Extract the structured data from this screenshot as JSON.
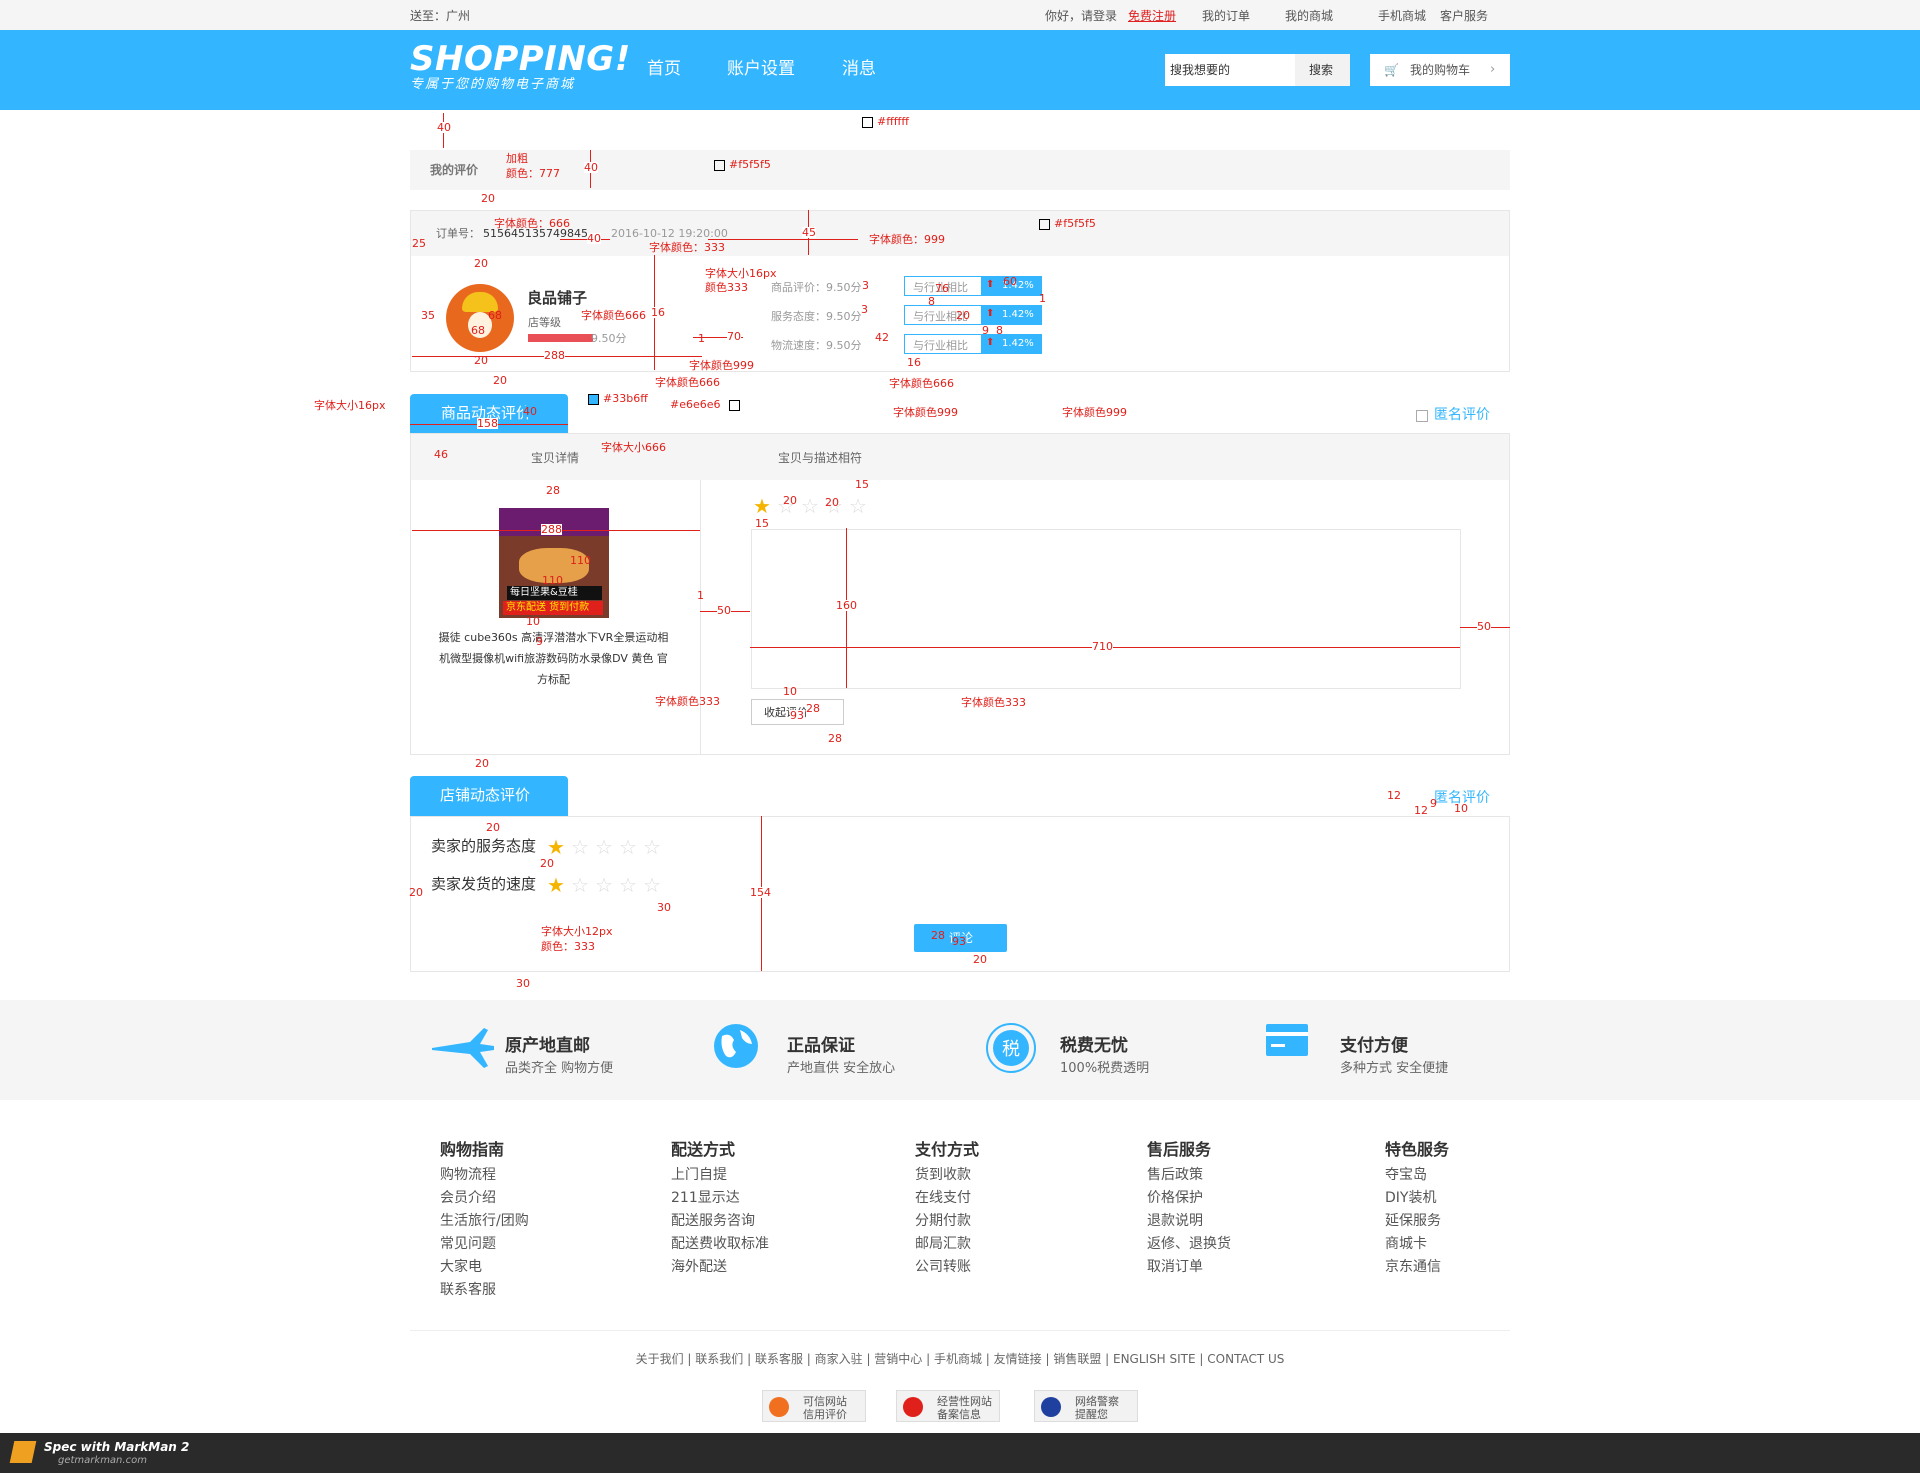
{
  "topbar": {
    "location": "送至：广州",
    "greeting": "你好，请登录",
    "register": "免费注册",
    "my_orders": "我的订单",
    "my_mall": "我的商城",
    "mobile_mall": "手机商城",
    "customer_service": "客户服务"
  },
  "header": {
    "logo": "SHOPPING!",
    "slogan": "专属于您的购物电子商城",
    "nav": [
      "首页",
      "账户设置",
      "消息"
    ],
    "search_placeholder": "搜我想要的",
    "search_button": "搜索",
    "cart": "我的购物车"
  },
  "review": {
    "section_title": "我的评价",
    "order_label": "订单号：",
    "order_no": "515645135749845",
    "order_time": "2016-10-12   19:20:00",
    "shop_name": "良品铺子",
    "shop_level": "店等级",
    "shop_score": "9.50分",
    "metrics": [
      {
        "label": "商品评价：9.50分",
        "compare": "与行业相比",
        "value": "1.42%"
      },
      {
        "label": "服务态度：9.50分",
        "compare": "与行业相比",
        "value": "1.42%"
      },
      {
        "label": "物流速度：9.50分",
        "compare": "与行业相比",
        "value": "1.42%"
      }
    ],
    "product_tab": "商品动态评价",
    "anonymous": "匿名评价",
    "col_product": "宝贝详情",
    "col_match": "宝贝与描述相符",
    "product_img_text1": "每日坚果&豆桂",
    "product_img_text2": "京东配送 货到付款",
    "product_title": "摄徒 cube360s 高清浮潜潜水下VR全景运动相机微型摄像机wifi旅游数码防水录像DV 黄色 官方标配",
    "collapse_btn": "收起评价",
    "match_rating": 1,
    "shop_tab": "店铺动态评价",
    "service_label": "卖家的服务态度",
    "delivery_label": "卖家发货的速度",
    "service_rating": 1,
    "delivery_rating": 1,
    "submit_btn": "评论"
  },
  "annotations": {
    "a40": "40",
    "a20": "20",
    "a25": "25",
    "a45": "45",
    "a35": "35",
    "a68": "68",
    "a288": "288",
    "a16": "16",
    "a1": "1",
    "a3": "3",
    "a8": "8",
    "a9": "9",
    "a60": "60",
    "a70": "70",
    "a42": "42",
    "a76": "76",
    "a158": "158",
    "a46": "46",
    "a28": "28",
    "a15": "15",
    "a110": "110",
    "a10": "10",
    "a50": "50",
    "a160": "160",
    "a710": "710",
    "a93": "93",
    "a154": "154",
    "a30": "30",
    "a12": "12",
    "ffffff": "#ffffff",
    "f5f5f5": "#f5f5f5",
    "c33b6ff": "#33b6ff",
    "e6e6e6": "#e6e6e6",
    "bold": "加粗",
    "color777": "颜色：777",
    "fc666": "字体颜色：666",
    "fc333": "字体颜色：333",
    "fc999": "字体颜色：999",
    "fs16": "字体大小16px",
    "c333": "颜色333",
    "fc666b": "字体颜色666",
    "fc999b": "字体颜色999",
    "fs16b": "字体大小16px",
    "fs666": "字体大小666",
    "fc333b": "字体颜色333",
    "fs12": "字体大小12px",
    "c333b": "颜色：333"
  },
  "features": [
    {
      "title": "原产地直邮",
      "sub": "品类齐全 购物方便",
      "icon": "plane-icon"
    },
    {
      "title": "正品保证",
      "sub": "产地直供 安全放心",
      "icon": "globe-icon"
    },
    {
      "title": "税费无忧",
      "sub": "100%税费透明",
      "icon": "tax-icon"
    },
    {
      "title": "支付方便",
      "sub": "多种方式 安全便捷",
      "icon": "card-icon"
    }
  ],
  "footer_cols": [
    {
      "title": "购物指南",
      "items": [
        "购物流程",
        "会员介绍",
        "生活旅行/团购",
        "常见问题",
        "大家电",
        "联系客服"
      ]
    },
    {
      "title": "配送方式",
      "items": [
        "上门自提",
        "211显示达",
        "配送服务咨询",
        "配送费收取标准",
        "海外配送"
      ]
    },
    {
      "title": "支付方式",
      "items": [
        "货到收款",
        "在线支付",
        "分期付款",
        "邮局汇款",
        "公司转账"
      ]
    },
    {
      "title": "售后服务",
      "items": [
        "售后政策",
        "价格保护",
        "退款说明",
        "返修、退换货",
        "取消订单"
      ]
    },
    {
      "title": "特色服务",
      "items": [
        "夺宝岛",
        "DIY装机",
        "延保服务",
        "商城卡",
        "京东通信"
      ]
    }
  ],
  "footer_links": "关于我们 | 联系我们 | 联系客服 | 商家入驻 | 营销中心 | 手机商城 | 友情链接 | 销售联盟 | ENGLISH SITE | CONTACT US",
  "badges": [
    {
      "l1": "可信网站",
      "l2": "信用评价"
    },
    {
      "l1": "经营性网站",
      "l2": "备案信息"
    },
    {
      "l1": "网络警察",
      "l2": "提醒您"
    }
  ],
  "markman": {
    "line1": "Spec with MarkMan 2",
    "line2": "getmarkman.com"
  },
  "colors": {
    "accent": "#33b6ff",
    "annotation": "#e0201a",
    "bg_gray": "#f5f5f5",
    "border": "#e6e6e6"
  }
}
